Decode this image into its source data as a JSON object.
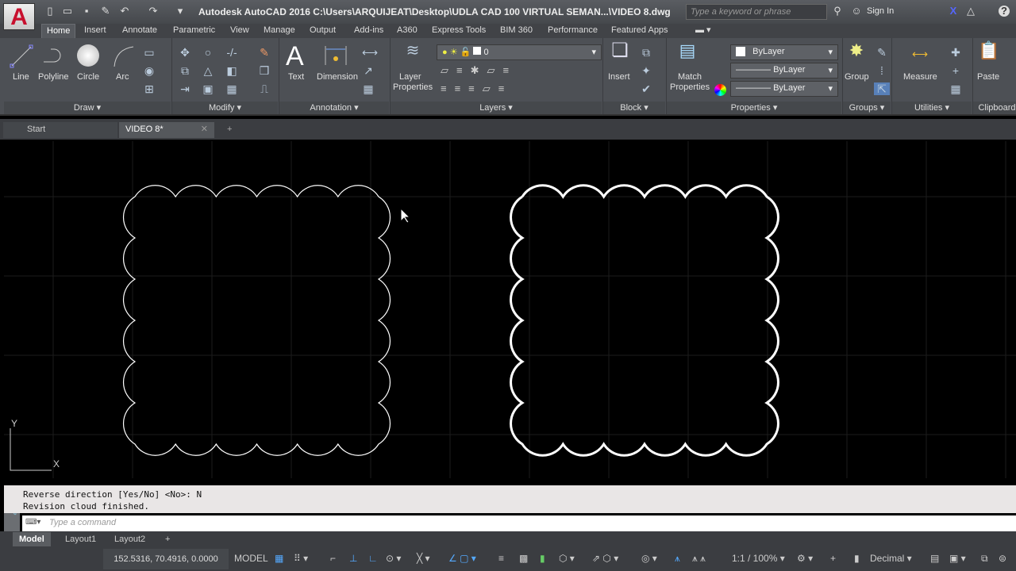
{
  "app": {
    "logo": "A",
    "title": "Autodesk AutoCAD 2016    C:\\Users\\ARQUIJEAT\\Desktop\\UDLA CAD 100 VIRTUAL SEMAN...\\VIDEO 8.dwg",
    "search_placeholder": "Type a keyword or phrase",
    "sign_in": "Sign In"
  },
  "ribbon_tabs": [
    "Home",
    "Insert",
    "Annotate",
    "Parametric",
    "View",
    "Manage",
    "Output",
    "Add-ins",
    "A360",
    "Express Tools",
    "BIM 360",
    "Performance",
    "Featured Apps"
  ],
  "draw": {
    "label": "Draw",
    "line": "Line",
    "polyline": "Polyline",
    "circle": "Circle",
    "arc": "Arc"
  },
  "modify": {
    "label": "Modify"
  },
  "annotation": {
    "label": "Annotation",
    "text": "Text",
    "dimension": "Dimension"
  },
  "layers": {
    "label": "Layers",
    "layer_properties_1": "Layer",
    "layer_properties_2": "Properties",
    "current_layer": "0"
  },
  "block": {
    "label": "Block",
    "insert": "Insert"
  },
  "properties": {
    "label": "Properties",
    "match_1": "Match",
    "match_2": "Properties",
    "color": "ByLayer",
    "linetype": "ByLayer",
    "lineweight": "ByLayer"
  },
  "groups": {
    "label": "Groups",
    "group": "Group"
  },
  "utilities": {
    "label": "Utilities",
    "measure": "Measure"
  },
  "clipboard": {
    "label": "Clipboard",
    "paste": "Paste"
  },
  "doc_tabs": {
    "start": "Start",
    "active": "VIDEO 8*"
  },
  "ucs": {
    "y": "Y",
    "x": "X"
  },
  "command": {
    "history": [
      "Reverse direction [Yes/No] <No>: N",
      "Revision cloud finished."
    ],
    "placeholder": "Type a command"
  },
  "layout_tabs": [
    "Model",
    "Layout1",
    "Layout2"
  ],
  "status": {
    "coords": "152.5316, 70.4916, 0.0000",
    "space": "MODEL",
    "scale": "1:1 / 100%",
    "units": "Decimal"
  },
  "colors": {
    "accent": "#c8102e",
    "canvas": "#000000",
    "grid": "#1c1c1c"
  }
}
